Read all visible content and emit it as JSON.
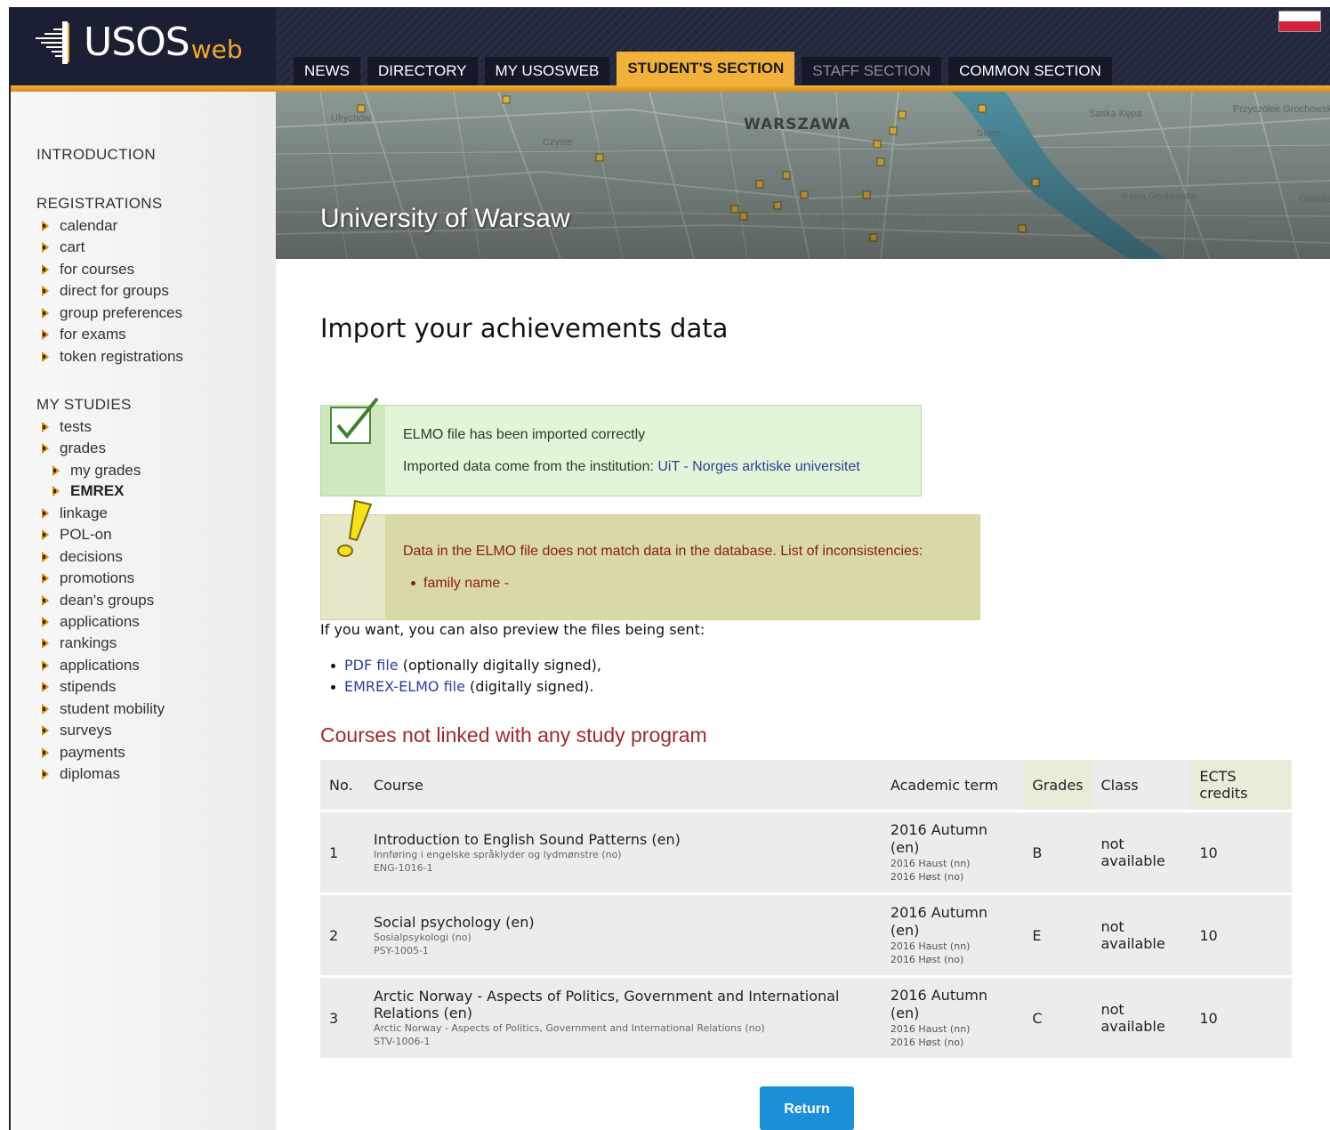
{
  "header": {
    "logo_text": "USOS",
    "logo_suffix": "web",
    "tabs": [
      {
        "label": "NEWS"
      },
      {
        "label": "DIRECTORY"
      },
      {
        "label": "MY USOSWEB"
      },
      {
        "label": "STUDENT'S SECTION"
      },
      {
        "label": "STAFF SECTION"
      },
      {
        "label": "COMMON SECTION"
      }
    ]
  },
  "banner": {
    "title": "University of Warsaw",
    "map_labels": [
      "Ulrychów",
      "WARSZAWA",
      "Czyste",
      "Solec",
      "Saska Kępa",
      "Przyczółek Grochowski",
      "Kępa Gocławska",
      "Śródmieście Południowe",
      "Osiedle Jantar"
    ]
  },
  "sidebar": {
    "introduction": "INTRODUCTION",
    "registrations": {
      "heading": "REGISTRATIONS",
      "items": [
        "calendar",
        "cart",
        "for courses",
        "direct for groups",
        "group preferences",
        "for exams",
        "token registrations"
      ]
    },
    "my_studies": {
      "heading": "MY STUDIES",
      "items": [
        "tests",
        "grades",
        "my grades",
        "EMREX",
        "linkage",
        "POL-on",
        "decisions",
        "promotions",
        "dean's groups",
        "applications",
        "rankings",
        "applications",
        "stipends",
        "student mobility",
        "surveys",
        "payments",
        "diplomas"
      ]
    }
  },
  "main": {
    "title": "Import your achievements data",
    "success": {
      "line1": "ELMO file has been imported correctly",
      "line2_prefix": "Imported data come from the institution: ",
      "line2_link": "UiT - Norges arktiske universitet"
    },
    "warning": {
      "line1": "Data in the ELMO file does not match data in the database. List of inconsistencies:",
      "item": "family name -"
    },
    "preview": {
      "intro": "If you want, you can also preview the files being sent:",
      "items": [
        {
          "link": "PDF file",
          "suffix": " (optionally digitally signed),"
        },
        {
          "link": "EMREX-ELMO file",
          "suffix": " (digitally signed)."
        }
      ]
    },
    "section_title": "Courses not linked with any study program",
    "table": {
      "headers": [
        "No.",
        "Course",
        "Academic term",
        "Grades",
        "Class",
        "ECTS credits"
      ],
      "rows": [
        {
          "no": "1",
          "course": "Introduction to English Sound Patterns (en)",
          "course_no": "Innføring i engelske språklyder og lydmønstre (no)",
          "code": "ENG-1016-1",
          "term": "2016 Autumn (en)",
          "term_nn": "2016 Haust (nn)",
          "term_no": "2016 Høst (no)",
          "grade": "B",
          "class": "not available",
          "ects": "10"
        },
        {
          "no": "2",
          "course": "Social psychology (en)",
          "course_no": "Sosialpsykologi (no)",
          "code": "PSY-1005-1",
          "term": "2016 Autumn (en)",
          "term_nn": "2016 Haust (nn)",
          "term_no": "2016 Høst (no)",
          "grade": "E",
          "class": "not available",
          "ects": "10"
        },
        {
          "no": "3",
          "course": "Arctic Norway - Aspects of Politics, Government and International Relations (en)",
          "course_no": "Arctic Norway - Aspects of Politics, Government and International Relations (no)",
          "code": "STV-1006-1",
          "term": "2016 Autumn (en)",
          "term_nn": "2016 Haust (nn)",
          "term_no": "2016 Høst (no)",
          "grade": "C",
          "class": "not available",
          "ects": "10"
        }
      ]
    },
    "return_label": "Return"
  },
  "colors": {
    "header_bg": "#23283f",
    "accent_orange": "#f2b13a",
    "success_bg": "#e3f5d8",
    "warning_bg": "#d9d8a8",
    "section_title": "#a02a28",
    "button": "#1d8fd6",
    "link": "#2d3e9c"
  }
}
